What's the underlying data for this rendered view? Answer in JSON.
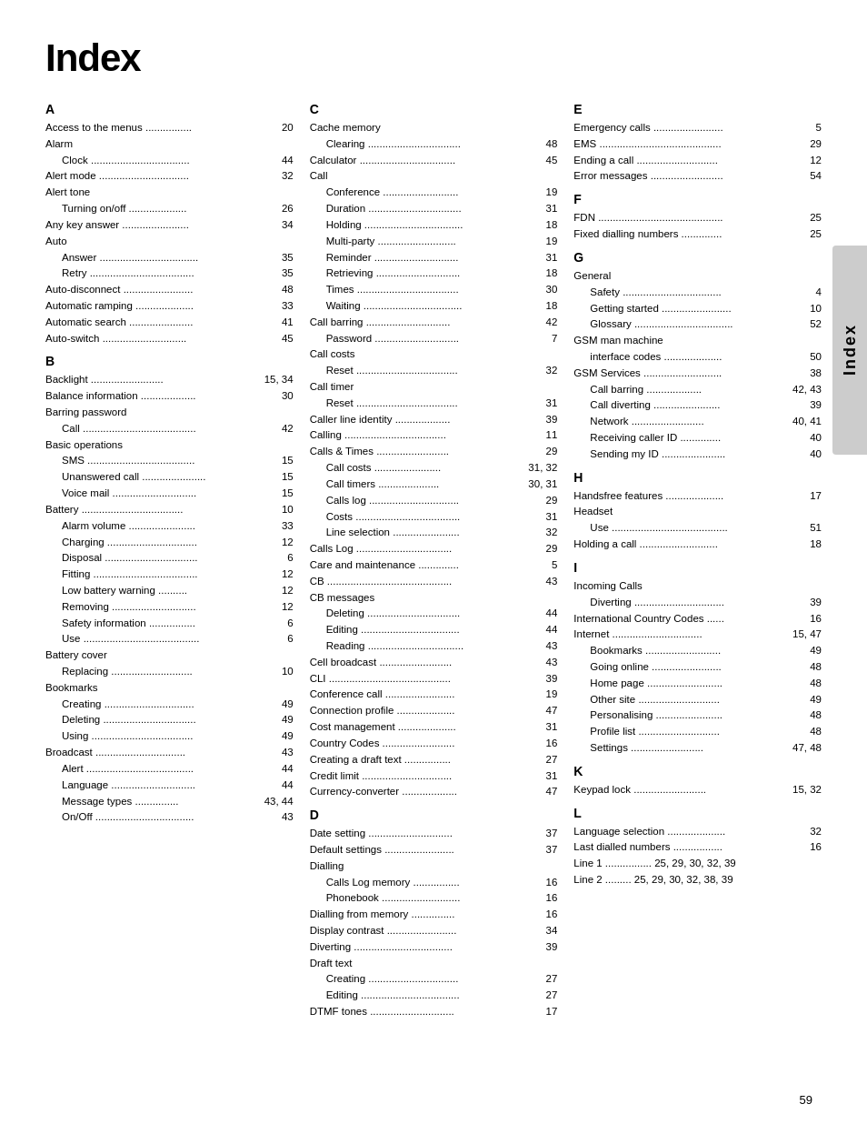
{
  "title": "Index",
  "page_number": "59",
  "sidebar_label": "Index",
  "col1": {
    "sections": [
      {
        "letter": "A",
        "entries": [
          {
            "label": "Access to the menus  ................",
            "page": "20",
            "indent": 0
          },
          {
            "label": "Alarm",
            "page": "",
            "indent": 0
          },
          {
            "label": "Clock  ..................................",
            "page": "44",
            "indent": 1
          },
          {
            "label": "Alert mode  ...............................",
            "page": "32",
            "indent": 0
          },
          {
            "label": "Alert tone",
            "page": "",
            "indent": 0
          },
          {
            "label": "Turning on/off  ....................",
            "page": "26",
            "indent": 1
          },
          {
            "label": "Any key answer  .......................",
            "page": "34",
            "indent": 0
          },
          {
            "label": "Auto",
            "page": "",
            "indent": 0
          },
          {
            "label": "Answer  ..................................",
            "page": "35",
            "indent": 1
          },
          {
            "label": "Retry  ....................................",
            "page": "35",
            "indent": 1
          },
          {
            "label": "Auto-disconnect  ........................",
            "page": "48",
            "indent": 0
          },
          {
            "label": "Automatic ramping  ....................",
            "page": "33",
            "indent": 0
          },
          {
            "label": "Automatic search  ......................",
            "page": "41",
            "indent": 0
          },
          {
            "label": "Auto-switch  .............................",
            "page": "45",
            "indent": 0
          }
        ]
      },
      {
        "letter": "B",
        "entries": [
          {
            "label": "Backlight  .........................",
            "page": "15, 34",
            "indent": 0
          },
          {
            "label": "Balance information  ...................",
            "page": "30",
            "indent": 0
          },
          {
            "label": "Barring password",
            "page": "",
            "indent": 0
          },
          {
            "label": "Call  .......................................",
            "page": "42",
            "indent": 1
          },
          {
            "label": "Basic operations",
            "page": "",
            "indent": 0
          },
          {
            "label": "SMS  .....................................",
            "page": "15",
            "indent": 1
          },
          {
            "label": "Unanswered call  ......................",
            "page": "15",
            "indent": 1
          },
          {
            "label": "Voice mail  .............................",
            "page": "15",
            "indent": 1
          },
          {
            "label": "Battery  ...................................",
            "page": "10",
            "indent": 0
          },
          {
            "label": "Alarm volume  .......................",
            "page": "33",
            "indent": 1
          },
          {
            "label": "Charging  ...............................",
            "page": "12",
            "indent": 1
          },
          {
            "label": "Disposal  ................................",
            "page": "6",
            "indent": 1
          },
          {
            "label": "Fitting  ....................................",
            "page": "12",
            "indent": 1
          },
          {
            "label": "Low battery warning  ..........",
            "page": "12",
            "indent": 1
          },
          {
            "label": "Removing  .............................",
            "page": "12",
            "indent": 1
          },
          {
            "label": "Safety information  ................",
            "page": "6",
            "indent": 1
          },
          {
            "label": "Use  ........................................",
            "page": "6",
            "indent": 1
          },
          {
            "label": "Battery cover",
            "page": "",
            "indent": 0
          },
          {
            "label": "Replacing  ............................",
            "page": "10",
            "indent": 1
          },
          {
            "label": "Bookmarks",
            "page": "",
            "indent": 0
          },
          {
            "label": "Creating  ...............................",
            "page": "49",
            "indent": 1
          },
          {
            "label": "Deleting  ................................",
            "page": "49",
            "indent": 1
          },
          {
            "label": "Using  ...................................",
            "page": "49",
            "indent": 1
          },
          {
            "label": "Broadcast  ...............................",
            "page": "43",
            "indent": 0
          },
          {
            "label": "Alert  .....................................",
            "page": "44",
            "indent": 1
          },
          {
            "label": "Language  .............................",
            "page": "44",
            "indent": 1
          },
          {
            "label": "Message types  ...............",
            "page": "43, 44",
            "indent": 1
          },
          {
            "label": "On/Off  ..................................",
            "page": "43",
            "indent": 1
          }
        ]
      }
    ]
  },
  "col2": {
    "sections": [
      {
        "letter": "C",
        "entries": [
          {
            "label": "Cache memory",
            "page": "",
            "indent": 0
          },
          {
            "label": "Clearing  ................................",
            "page": "48",
            "indent": 1
          },
          {
            "label": "Calculator  .................................",
            "page": "45",
            "indent": 0
          },
          {
            "label": "Call",
            "page": "",
            "indent": 0
          },
          {
            "label": "Conference  ..........................",
            "page": "19",
            "indent": 1
          },
          {
            "label": "Duration  ................................",
            "page": "31",
            "indent": 1
          },
          {
            "label": "Holding  ..................................",
            "page": "18",
            "indent": 1
          },
          {
            "label": "Multi-party  ...........................",
            "page": "19",
            "indent": 1
          },
          {
            "label": "Reminder  .............................",
            "page": "31",
            "indent": 1
          },
          {
            "label": "Retrieving  .............................",
            "page": "18",
            "indent": 1
          },
          {
            "label": "Times  ...................................",
            "page": "30",
            "indent": 1
          },
          {
            "label": "Waiting  ..................................",
            "page": "18",
            "indent": 1
          },
          {
            "label": "Call barring  .............................",
            "page": "42",
            "indent": 0
          },
          {
            "label": "Password  .............................",
            "page": "7",
            "indent": 1
          },
          {
            "label": "Call costs",
            "page": "",
            "indent": 0
          },
          {
            "label": "Reset  ...................................",
            "page": "32",
            "indent": 1
          },
          {
            "label": "Call timer",
            "page": "",
            "indent": 0
          },
          {
            "label": "Reset  ...................................",
            "page": "31",
            "indent": 1
          },
          {
            "label": "Caller line identity  ...................",
            "page": "39",
            "indent": 0
          },
          {
            "label": "Calling  ...................................",
            "page": "11",
            "indent": 0
          },
          {
            "label": "Calls & Times  .........................",
            "page": "29",
            "indent": 0
          },
          {
            "label": "Call costs  .......................",
            "page": "31, 32",
            "indent": 1
          },
          {
            "label": "Call timers  .....................",
            "page": "30, 31",
            "indent": 1
          },
          {
            "label": "Calls log  ...............................",
            "page": "29",
            "indent": 1
          },
          {
            "label": "Costs  ....................................",
            "page": "31",
            "indent": 1
          },
          {
            "label": "Line selection  .......................",
            "page": "32",
            "indent": 1
          },
          {
            "label": "Calls Log  .................................",
            "page": "29",
            "indent": 0
          },
          {
            "label": "Care and maintenance  ..............",
            "page": "5",
            "indent": 0
          },
          {
            "label": "CB  ...........................................",
            "page": "43",
            "indent": 0
          },
          {
            "label": "CB messages",
            "page": "",
            "indent": 0
          },
          {
            "label": "Deleting  ................................",
            "page": "44",
            "indent": 1
          },
          {
            "label": "Editing  ..................................",
            "page": "44",
            "indent": 1
          },
          {
            "label": "Reading  .................................",
            "page": "43",
            "indent": 1
          },
          {
            "label": "Cell broadcast  .........................",
            "page": "43",
            "indent": 0
          },
          {
            "label": "CLI  ..........................................",
            "page": "39",
            "indent": 0
          },
          {
            "label": "Conference call  ........................",
            "page": "19",
            "indent": 0
          },
          {
            "label": "Connection profile  ....................",
            "page": "47",
            "indent": 0
          },
          {
            "label": "Cost management  ....................",
            "page": "31",
            "indent": 0
          },
          {
            "label": "Country Codes  .........................",
            "page": "16",
            "indent": 0
          },
          {
            "label": "Creating a draft text  ................",
            "page": "27",
            "indent": 0
          },
          {
            "label": "Credit limit  ...............................",
            "page": "31",
            "indent": 0
          },
          {
            "label": "Currency-converter  ...................",
            "page": "47",
            "indent": 0
          }
        ]
      },
      {
        "letter": "D",
        "entries": [
          {
            "label": "Date setting  .............................",
            "page": "37",
            "indent": 0
          },
          {
            "label": "Default settings  ........................",
            "page": "37",
            "indent": 0
          },
          {
            "label": "Dialling",
            "page": "",
            "indent": 0
          },
          {
            "label": "Calls Log memory  ................",
            "page": "16",
            "indent": 1
          },
          {
            "label": "Phonebook  ...........................",
            "page": "16",
            "indent": 1
          },
          {
            "label": "Dialling from memory  ...............",
            "page": "16",
            "indent": 0
          },
          {
            "label": "Display contrast  ........................",
            "page": "34",
            "indent": 0
          },
          {
            "label": "Diverting  ..................................",
            "page": "39",
            "indent": 0
          },
          {
            "label": "Draft text",
            "page": "",
            "indent": 0
          },
          {
            "label": "Creating  ...............................",
            "page": "27",
            "indent": 1
          },
          {
            "label": "Editing  ..................................",
            "page": "27",
            "indent": 1
          },
          {
            "label": "DTMF tones  .............................",
            "page": "17",
            "indent": 0
          }
        ]
      }
    ]
  },
  "col3": {
    "sections": [
      {
        "letter": "E",
        "entries": [
          {
            "label": "Emergency calls  ........................",
            "page": "5",
            "indent": 0
          },
          {
            "label": "EMS  ..........................................",
            "page": "29",
            "indent": 0
          },
          {
            "label": "Ending a call  ............................",
            "page": "12",
            "indent": 0
          },
          {
            "label": "Error messages  .........................",
            "page": "54",
            "indent": 0
          }
        ]
      },
      {
        "letter": "F",
        "entries": [
          {
            "label": "FDN  ...........................................",
            "page": "25",
            "indent": 0
          },
          {
            "label": "Fixed dialling numbers  ..............",
            "page": "25",
            "indent": 0
          }
        ]
      },
      {
        "letter": "G",
        "entries": [
          {
            "label": "General",
            "page": "",
            "indent": 0
          },
          {
            "label": "Safety  ..................................",
            "page": "4",
            "indent": 1
          },
          {
            "label": "Getting started  ........................",
            "page": "10",
            "indent": 1
          },
          {
            "label": "Glossary  ..................................",
            "page": "52",
            "indent": 1
          },
          {
            "label": "GSM man machine",
            "page": "",
            "indent": 0
          },
          {
            "label": "interface codes  ....................",
            "page": "50",
            "indent": 1
          },
          {
            "label": "GSM Services  ...........................",
            "page": "38",
            "indent": 0
          },
          {
            "label": "Call barring  ...................",
            "page": "42, 43",
            "indent": 1
          },
          {
            "label": "Call diverting  .......................",
            "page": "39",
            "indent": 1
          },
          {
            "label": "Network  .........................",
            "page": "40, 41",
            "indent": 1
          },
          {
            "label": "Receiving caller ID  ..............",
            "page": "40",
            "indent": 1
          },
          {
            "label": "Sending my ID  ......................",
            "page": "40",
            "indent": 1
          }
        ]
      },
      {
        "letter": "H",
        "entries": [
          {
            "label": "Handsfree features  ....................",
            "page": "17",
            "indent": 0
          },
          {
            "label": "Headset",
            "page": "",
            "indent": 0
          },
          {
            "label": "Use  ........................................",
            "page": "51",
            "indent": 1
          },
          {
            "label": "Holding a call  ...........................",
            "page": "18",
            "indent": 0
          }
        ]
      },
      {
        "letter": "I",
        "entries": [
          {
            "label": "Incoming Calls",
            "page": "",
            "indent": 0
          },
          {
            "label": "Diverting  ...............................",
            "page": "39",
            "indent": 1
          },
          {
            "label": "International Country Codes  ......",
            "page": "16",
            "indent": 0
          },
          {
            "label": "Internet  ...............................",
            "page": "15, 47",
            "indent": 0
          },
          {
            "label": "Bookmarks  ..........................",
            "page": "49",
            "indent": 1
          },
          {
            "label": "Going online  ........................",
            "page": "48",
            "indent": 1
          },
          {
            "label": "Home page  ..........................",
            "page": "48",
            "indent": 1
          },
          {
            "label": "Other site  ............................",
            "page": "49",
            "indent": 1
          },
          {
            "label": "Personalising  .......................",
            "page": "48",
            "indent": 1
          },
          {
            "label": "Profile list  ............................",
            "page": "48",
            "indent": 1
          },
          {
            "label": "Settings  .........................",
            "page": "47, 48",
            "indent": 1
          }
        ]
      },
      {
        "letter": "K",
        "entries": [
          {
            "label": "Keypad lock  .........................",
            "page": "15, 32",
            "indent": 0
          }
        ]
      },
      {
        "letter": "L",
        "entries": [
          {
            "label": "Language selection  ....................",
            "page": "32",
            "indent": 0
          },
          {
            "label": "Last dialled numbers  .................",
            "page": "16",
            "indent": 0
          },
          {
            "label": "Line 1  ................  25, 29, 30, 32, 39",
            "page": "",
            "indent": 0
          },
          {
            "label": "Line 2  .........  25, 29, 30, 32, 38, 39",
            "page": "",
            "indent": 0
          }
        ]
      }
    ]
  }
}
